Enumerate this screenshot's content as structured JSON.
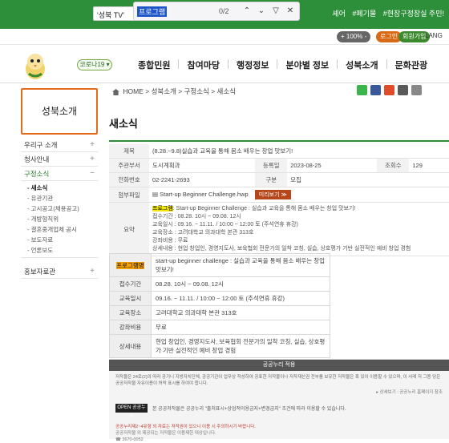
{
  "findbar": {
    "tab_text": "'성북 TV'",
    "query": "프로그램",
    "count": "0/2",
    "up": "⌃",
    "down": "⌄",
    "filter": "▽",
    "close": "✕"
  },
  "topbar": {
    "links": [
      "셰어",
      "#폐기물",
      "#현장구정장실 주민!"
    ]
  },
  "util": {
    "zoom": "+ 100% -",
    "login": "로그인",
    "join": "회원가입",
    "lang": "LANG"
  },
  "header": {
    "covid": "코로나19 ▾",
    "nav": [
      "종합민원",
      "참여마당",
      "행정정보",
      "분야별 정보",
      "성북소개",
      "문화관광"
    ]
  },
  "sidebar": {
    "title": "성북소개",
    "items": [
      {
        "label": "우리구 소개",
        "pm": "+"
      },
      {
        "label": "청사안내",
        "pm": "+"
      },
      {
        "label": "구정소식",
        "pm": "−"
      }
    ],
    "sub": [
      "새소식",
      "유관기관",
      "고시공고(채용공고)",
      "개방형직위",
      "결혼중개업체 공시",
      "보도자료",
      "언론보도"
    ],
    "after": {
      "label": "홍보자료관",
      "pm": "+"
    }
  },
  "breadcrumb": [
    "HOME",
    "성북소개",
    "구정소식",
    "새소식"
  ],
  "page_title": "새소식",
  "info": {
    "title_label": "제목",
    "title": "(8.28.~9.8)실습과 교육을 통해 몸소 배우는 창업 맛보기!",
    "dept_label": "주관부서",
    "dept": "도시계획과",
    "date_label": "등록일",
    "date": "2023-08-25",
    "views_label": "조회수",
    "views": "129",
    "phone_label": "전화번호",
    "phone": "02-2241-2693",
    "kind_label": "구분",
    "kind": "모집",
    "attach_label": "첨부파일",
    "attach": "Start-up Beginner Challenge.hwp",
    "attach_btn": "미리보기 ≫",
    "summary_label": "요약",
    "summary_find": "프로그램",
    "summary_lines": [
      ": Start-up Beginner Challenge : 실습과 교육을 통해 몸소 배우는 창업 맛보기!",
      "접수기간 : 08.28. 10시 ~ 09.08. 12시",
      "교육일시 : 09.16. ~ 11.11. / 10:00 ~ 12:00 토 (주석연휴 휴강)",
      "교육장소 : 고려대학교 의과대학 본관 313호",
      "강좌비용 : 무료",
      "상세내용 : 현업 창업인, 경영지도사, 보육협회 전문가의 일착 코칭, 실습, 상호평가 기반 실전적인 예비 창업 경험"
    ]
  },
  "detail": {
    "rows": [
      {
        "label": "프로그램명",
        "value": "start-up beginner challenge : 실습과 교육을 통해 몸소 배우는 창업 맛보기!"
      },
      {
        "label": "접수기간",
        "value": "08.28. 10시 ~ 09.08. 12시"
      },
      {
        "label": "교육일시",
        "value": "09.16. ~ 11.11. / 10:00 ~ 12:00 토 (추석연휴 휴강)"
      },
      {
        "label": "교육장소",
        "value": "고려대학교 의과대학 본관 313호"
      },
      {
        "label": "강좌비용",
        "value": "무료"
      },
      {
        "label": "상세내용",
        "value": "현업 창업인, 경영지도사, 보육협회 전문가의 일착 코칭, 실습, 상호평가 기반 실전적인 예비 창업 경험"
      }
    ]
  },
  "footer": {
    "head": "공공누리 적용",
    "text": "저작물은 24로(2)의 따라 공기니 지방자치단체, 공공기관이 업무상 작성하여 공표한 저작물이나 저작재산권 전부를 보유한 저작물은 혹 있이 이용할 수 있으며, 이 사례 저 그용 당은 공공저작물 자유이용이 허락 표시를 하여야 합니다.",
    "more": "▸ 상세보기 : 공공누리 홈페이지 참조",
    "ccl": "OPEN 공공누리",
    "ccl_text": "본 공공저작물은 공공누리 \"출처표시+상업적이용금지+변경금지\" 조건에 따라 이용할 수 있습니다.",
    "small1": "공공누리제2~4유형 외 자료는 저작권이 있으니 이용 시 주의하시기 바랍니다.",
    "small2": "공공저작물 외 제공되는 저작물은 이용제한 대상입니다.",
    "phone": "☎ 3670-0052"
  }
}
